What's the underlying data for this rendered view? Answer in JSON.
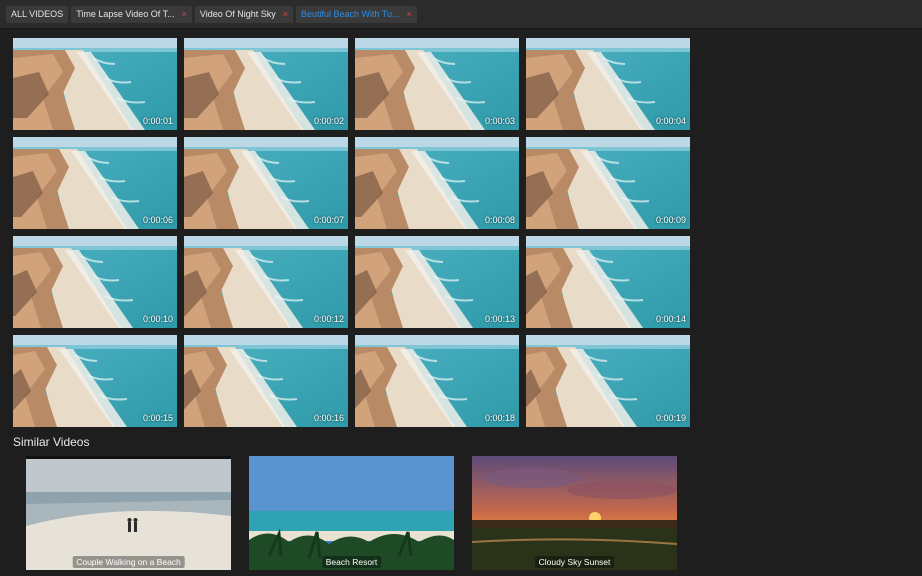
{
  "tabs": [
    {
      "label": "ALL VIDEOS",
      "closable": false,
      "active": false
    },
    {
      "label": "Time Lapse Video Of T...",
      "closable": true,
      "active": false
    },
    {
      "label": "Video Of Night Sky",
      "closable": true,
      "active": false
    },
    {
      "label": "Beutiful Beach With Tu...",
      "closable": true,
      "active": true
    }
  ],
  "close_glyph": "×",
  "frames": [
    "0:00:01",
    "0:00:02",
    "0:00:03",
    "0:00:04",
    "0:00:06",
    "0:00:07",
    "0:00:08",
    "0:00:09",
    "0:00:10",
    "0:00:12",
    "0:00:13",
    "0:00:14",
    "0:00:15",
    "0:00:16",
    "0:00:18",
    "0:00:19"
  ],
  "similar": {
    "title": "Similar Videos",
    "items": [
      {
        "caption": "Couple Walking on a Beach",
        "scene": "couple"
      },
      {
        "caption": "Beach Resort",
        "scene": "resort"
      },
      {
        "caption": "Cloudy Sky Sunset",
        "scene": "sunset"
      }
    ]
  },
  "colors": {
    "active_tab": "#2f8de4",
    "close": "#e0474c",
    "background": "#1e1e1e",
    "tabbar": "#2b2b2b"
  }
}
